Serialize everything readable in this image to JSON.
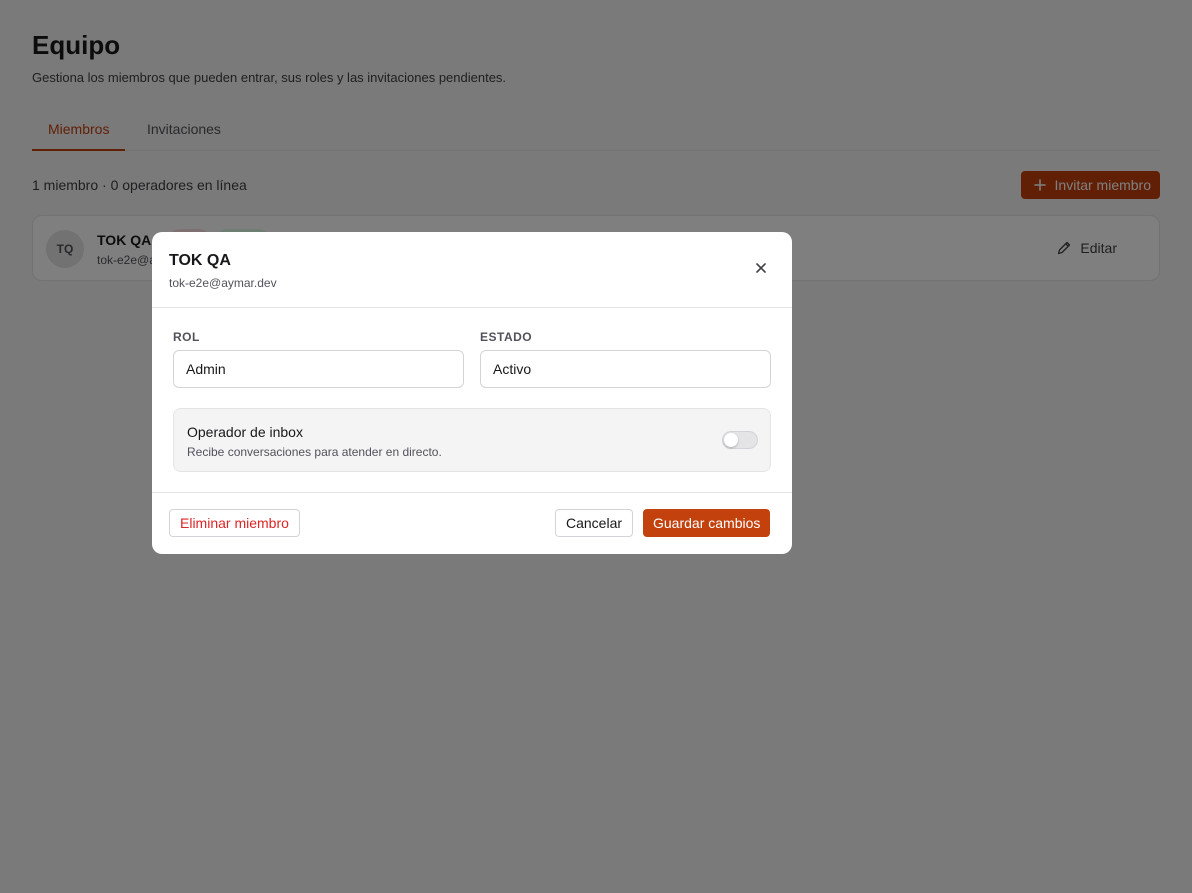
{
  "page": {
    "title": "Equipo",
    "subtitle": "Gestiona los miembros que pueden entrar, sus roles y las invitaciones pendientes."
  },
  "tabs": [
    {
      "label": "Miembros",
      "active": true
    },
    {
      "label": "Invitaciones",
      "active": false
    }
  ],
  "summary": {
    "counts": "1 miembro · 0 operadores en línea",
    "invite_label": "Invitar miembro"
  },
  "member": {
    "initials": "TQ",
    "name": "TOK QA",
    "email": "tok-e2e@aymar.dev",
    "edit_label": "Editar"
  },
  "modal": {
    "title": "TOK QA",
    "subtitle": "tok-e2e@aymar.dev",
    "role_label": "Rol",
    "role_value": "Admin",
    "status_label": "Estado",
    "status_value": "Activo",
    "inbox_title": "Operador de inbox",
    "inbox_desc": "Recibe conversaciones para atender en directo.",
    "inbox_enabled": false,
    "delete_label": "Eliminar miembro",
    "cancel_label": "Cancelar",
    "save_label": "Guardar cambios"
  },
  "colors": {
    "accent": "#c2410c",
    "danger": "#dc2626"
  }
}
